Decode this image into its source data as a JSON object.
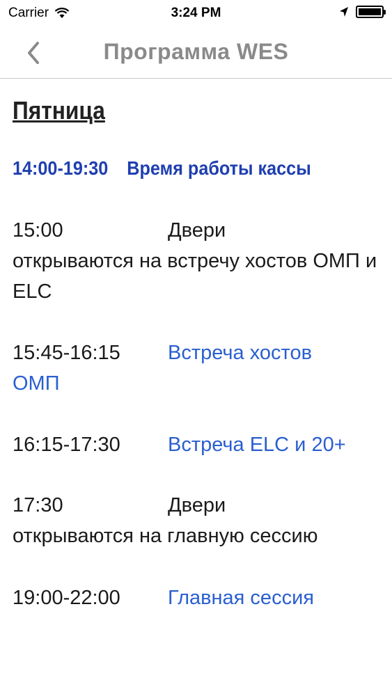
{
  "status_bar": {
    "carrier": "Carrier",
    "time": "3:24 PM",
    "icons": [
      "wifi-icon",
      "location-arrow-icon",
      "battery-icon"
    ]
  },
  "nav": {
    "back_icon": "chevron-left-icon",
    "title": "Программа WES"
  },
  "schedule": {
    "day": "Пятница",
    "highlight": {
      "time": "14:00-19:30",
      "description": "Время работы кассы"
    },
    "entries": [
      {
        "time": "15:00",
        "line1": "Двери",
        "line_rest": "открываются на встречу хостов ОМП и ELC"
      },
      {
        "time": "15:45-16:15",
        "link_line1": "Встреча хостов",
        "link_rest": "ОМП"
      },
      {
        "time": "16:15-17:30",
        "link_line1": "Встреча ELC и 20+"
      },
      {
        "time": "17:30",
        "line1": "Двери",
        "line_rest": "открываются на главную сессию"
      },
      {
        "time": "19:00-22:00",
        "link_line1": "Главная сессия"
      }
    ]
  },
  "colors": {
    "highlight": "#1f3fb0",
    "link": "#2a5fd0",
    "nav_title": "#8a8a8a"
  }
}
